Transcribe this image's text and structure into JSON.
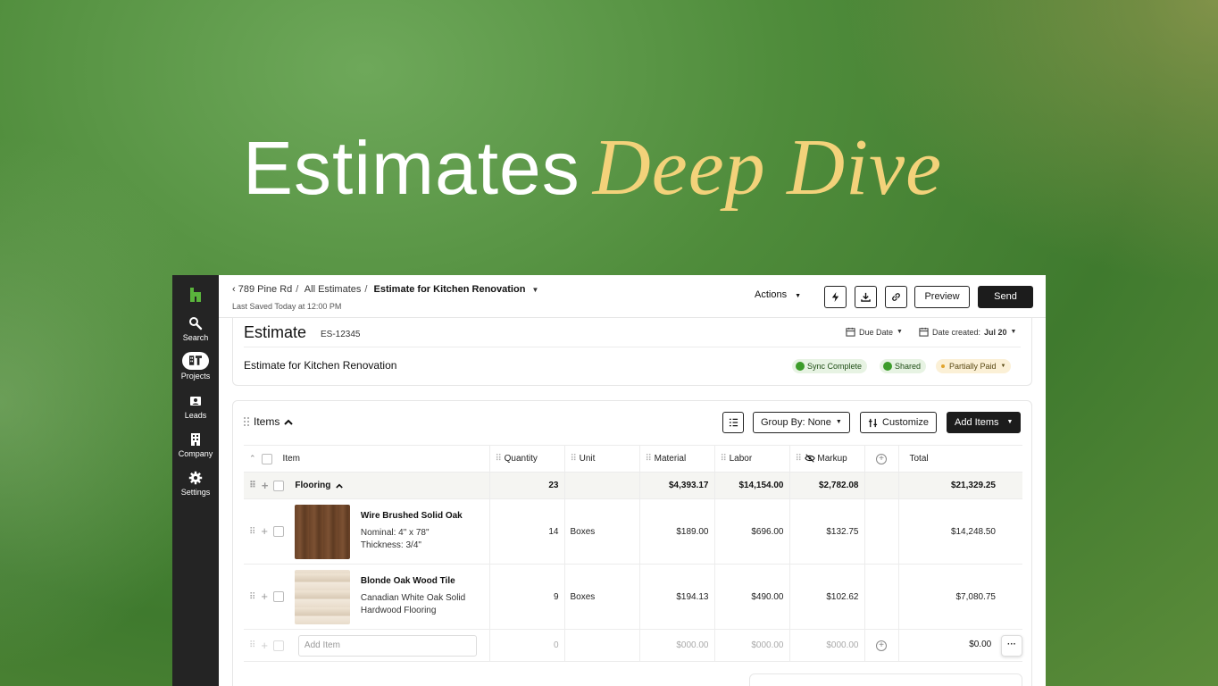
{
  "hero": {
    "title_main": "Estimates",
    "title_accent": "Deep Dive"
  },
  "colors": {
    "accent_gold": "#f3d27a",
    "sidebar_bg": "#242424",
    "brand_green": "#5ab43c",
    "send_bg": "#1c1c1c"
  },
  "sidebar": {
    "logo_icon": "houzz-logo-icon",
    "items": [
      {
        "label": "Search",
        "icon": "search-icon"
      },
      {
        "label": "Projects",
        "icon": "projects-icon",
        "active": true
      },
      {
        "label": "Leads",
        "icon": "leads-icon"
      },
      {
        "label": "Company",
        "icon": "company-icon"
      },
      {
        "label": "Settings",
        "icon": "gear-icon"
      }
    ]
  },
  "topbar": {
    "breadcrumb": [
      "789 Pine Rd",
      "All Estimates",
      "Estimate for Kitchen Renovation"
    ],
    "last_saved": "Last Saved Today at 12:00 PM",
    "actions_label": "Actions",
    "preview_label": "Preview",
    "send_label": "Send"
  },
  "estimate": {
    "title": "Estimate",
    "id": "ES-12345",
    "due_date_label": "Due Date",
    "date_created_label": "Date created:",
    "date_created_value": "Jul 20",
    "name": "Estimate for Kitchen Renovation",
    "badges": {
      "sync": "Sync Complete",
      "shared": "Shared",
      "payment": "Partially Paid"
    }
  },
  "items_section": {
    "title": "Items",
    "group_by_label": "Group By: None",
    "customize_label": "Customize",
    "add_items_label": "Add Items",
    "columns": [
      "Item",
      "Quantity",
      "Unit",
      "Material",
      "Labor",
      "Markup",
      "Total"
    ],
    "group": {
      "name": "Flooring",
      "quantity": "23",
      "material": "$4,393.17",
      "labor": "$14,154.00",
      "markup": "$2,782.08",
      "total": "$21,329.25"
    },
    "rows": [
      {
        "name": "Wire Brushed Solid Oak",
        "desc1": "Nominal: 4\" x 78\"",
        "desc2": "Thickness: 3/4\"",
        "quantity": "14",
        "unit": "Boxes",
        "material": "$189.00",
        "labor": "$696.00",
        "markup": "$132.75",
        "total": "$14,248.50"
      },
      {
        "name": "Blonde Oak Wood Tile",
        "desc1": "Canadian White Oak Solid",
        "desc2": "Hardwood Flooring",
        "quantity": "9",
        "unit": "Boxes",
        "material": "$194.13",
        "labor": "$490.00",
        "markup": "$102.62",
        "total": "$7,080.75"
      }
    ],
    "add_row": {
      "placeholder": "Add Item",
      "quantity": "0",
      "material": "$000.00",
      "labor": "$000.00",
      "markup": "$000.00",
      "total": "$0.00",
      "more": "···"
    }
  }
}
